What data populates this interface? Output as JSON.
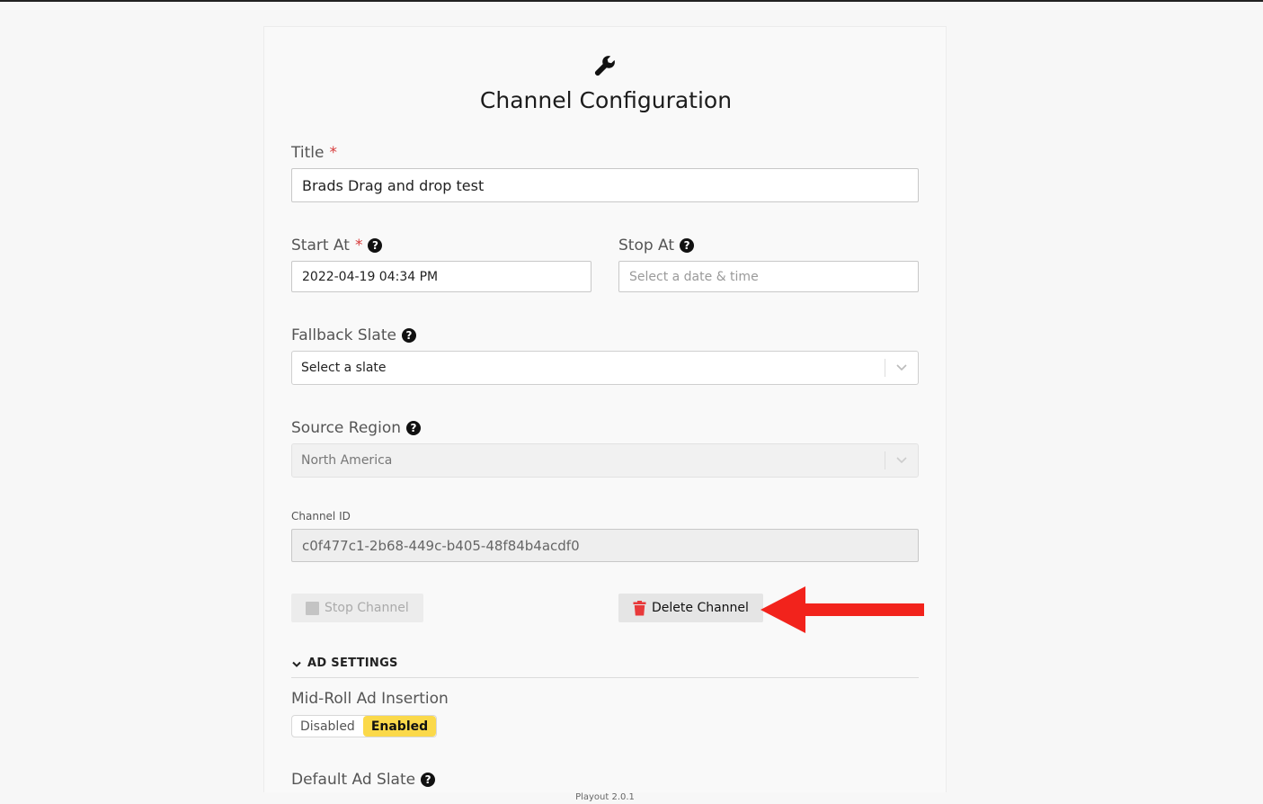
{
  "page": {
    "title": "Channel Configuration",
    "footer_version": "Playout 2.0.1"
  },
  "form": {
    "title": {
      "label": "Title",
      "required_mark": "*",
      "value": "Brads Drag and drop test"
    },
    "start_at": {
      "label": "Start At",
      "required_mark": "*",
      "value": "2022-04-19 04:34 PM"
    },
    "stop_at": {
      "label": "Stop At",
      "placeholder": "Select a date & time"
    },
    "fallback_slate": {
      "label": "Fallback Slate",
      "placeholder": "Select a slate"
    },
    "source_region": {
      "label": "Source Region",
      "value": "North America"
    },
    "channel_id": {
      "label": "Channel ID",
      "value": "c0f477c1-2b68-449c-b405-48f84b4acdf0"
    }
  },
  "actions": {
    "stop_label": "Stop Channel",
    "delete_label": "Delete Channel"
  },
  "ad_settings": {
    "section_label": "AD SETTINGS",
    "mid_roll_label": "Mid-Roll Ad Insertion",
    "toggle_off": "Disabled",
    "toggle_on": "Enabled",
    "default_slate_label": "Default Ad Slate"
  },
  "icons": {
    "header": "wrench-icon",
    "help": "question-circle-icon",
    "delete": "trash-icon",
    "stop": "stop-square-icon",
    "chevron": "chevron-down-icon",
    "annotation": "red-arrow-icon"
  },
  "colors": {
    "required": "#d63a3a",
    "toggle_active": "#fbd94a",
    "delete_icon": "#e8393a",
    "annotation_arrow": "#f2231c"
  }
}
